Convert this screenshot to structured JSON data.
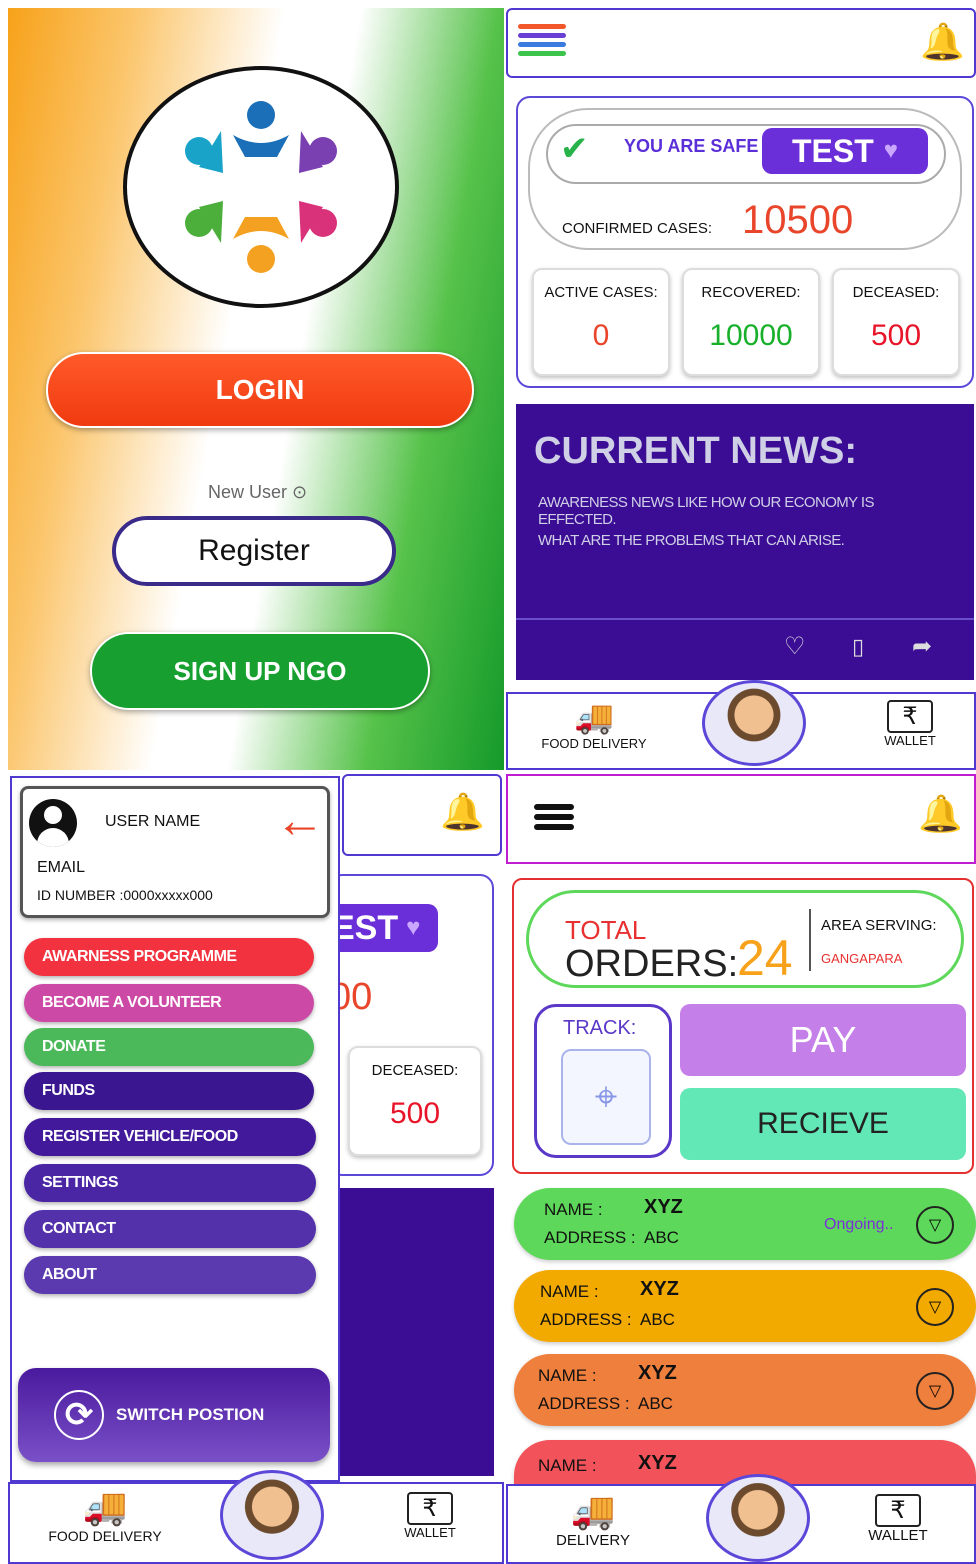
{
  "login_screen": {
    "login_label": "LOGIN",
    "new_user_label": "New User",
    "register_label": "Register",
    "signup_ngo_label": "SIGN UP NGO"
  },
  "dashboard": {
    "safe_label": "YOU ARE SAFE",
    "test_label": "TEST",
    "confirmed_label": "CONFIRMED CASES:",
    "confirmed_value": "10500",
    "active_label": "ACTIVE CASES:",
    "active_value": "0",
    "recovered_label": "RECOVERED:",
    "recovered_value": "10000",
    "deceased_label": "DECEASED:",
    "deceased_value": "500",
    "news_title": "CURRENT NEWS:",
    "news_line1": "AWARENESS NEWS LIKE  HOW OUR ECONOMY IS EFFECTED.",
    "news_line2": "WHAT ARE THE PROBLEMS THAT CAN ARISE.",
    "food_delivery_label": "FOOD DELIVERY",
    "wallet_label": "WALLET"
  },
  "drawer": {
    "user_name": "USER NAME",
    "email": "EMAIL",
    "id_number": "ID NUMBER :0000xxxxx000",
    "items": [
      {
        "label": "AWARNESS PROGRAMME",
        "color": "#f2323f"
      },
      {
        "label": "BECOME A VOLUNTEER",
        "color": "#cc4aa6"
      },
      {
        "label": "DONATE",
        "color": "#4bb85a"
      },
      {
        "label": "FUNDS",
        "color": "#3a1690"
      },
      {
        "label": "REGISTER VEHICLE/FOOD",
        "color": "#42199a"
      },
      {
        "label": "SETTINGS",
        "color": "#4a26a4"
      },
      {
        "label": "CONTACT",
        "color": "#5231aa"
      },
      {
        "label": "ABOUT",
        "color": "#5a3aae"
      }
    ],
    "switch_label": "SWITCH POSTION",
    "behind_test": "EST",
    "behind_value": "00",
    "deceased_label": "DECEASED:",
    "deceased_value": "500",
    "food_delivery_label": "FOOD DELIVERY",
    "wallet_label": "WALLET"
  },
  "orders": {
    "total_label": "TOTAL",
    "orders_label": "ORDERS:",
    "orders_value": "24",
    "area_label": "AREA SERVING:",
    "area_value": "GANGAPARA",
    "track_label": "TRACK:",
    "pay_label": "PAY",
    "receive_label": "RECIEVE",
    "name_label": "NAME :",
    "address_label": "ADDRESS :",
    "list": [
      {
        "name": "XYZ",
        "address": "ABC",
        "status": "Ongoing..",
        "color": "#5ed85a"
      },
      {
        "name": "XYZ",
        "address": "ABC",
        "status": "",
        "color": "#f2a900"
      },
      {
        "name": "XYZ",
        "address": "ABC",
        "status": "",
        "color": "#ef7f3c"
      },
      {
        "name": "XYZ",
        "address": "",
        "status": "",
        "color": "#f2535a"
      }
    ],
    "delivery_label": "DELIVERY",
    "wallet_label": "WALLET"
  }
}
